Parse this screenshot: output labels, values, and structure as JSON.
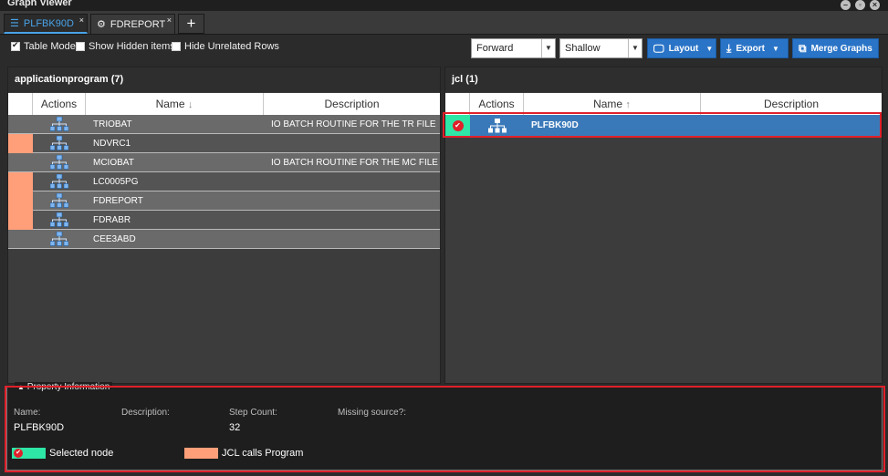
{
  "window": {
    "title": "Graph Viewer"
  },
  "tabs": [
    {
      "label": "PLFBK90D",
      "close": "×"
    },
    {
      "label": "FDREPORT",
      "close": "×"
    }
  ],
  "tab_add": "+",
  "toolbar": {
    "table_mode": "Table Mode",
    "show_hidden": "Show Hidden items",
    "hide_unrelated": "Hide Unrelated Rows",
    "direction": "Forward",
    "depth": "Shallow",
    "layout": "Layout",
    "export": "Export",
    "merge": "Merge Graphs"
  },
  "left_panel": {
    "title": "applicationprogram (7)",
    "columns": {
      "actions": "Actions",
      "name": "Name",
      "name_sort": "↓",
      "description": "Description"
    },
    "rows": [
      {
        "name": "TRIOBAT",
        "description": "IO BATCH ROUTINE FOR THE TR FILE",
        "marker": ""
      },
      {
        "name": "NDVRC1",
        "description": "",
        "marker": "#ff9f7a"
      },
      {
        "name": "MCIOBAT",
        "description": "IO BATCH ROUTINE FOR THE MC FILE",
        "marker": ""
      },
      {
        "name": "LC0005PG",
        "description": "",
        "marker": "#ff9f7a"
      },
      {
        "name": "FDREPORT",
        "description": "",
        "marker": "#ff9f7a"
      },
      {
        "name": "FDRABR",
        "description": "",
        "marker": "#ff9f7a"
      },
      {
        "name": "CEE3ABD",
        "description": "",
        "marker": ""
      }
    ]
  },
  "right_panel": {
    "title": "jcl (1)",
    "columns": {
      "actions": "Actions",
      "name": "Name",
      "name_sort": "↑",
      "description": "Description"
    },
    "rows": [
      {
        "name": "PLFBK90D",
        "description": ""
      }
    ]
  },
  "property": {
    "legend": "Property Information",
    "name_label": "Name:",
    "name_value": "PLFBK90D",
    "desc_label": "Description:",
    "step_label": "Step Count:",
    "step_value": "32",
    "missing_label": "Missing source?:",
    "legend_selected": "Selected node",
    "legend_jcl": "JCL calls Program"
  },
  "colors": {
    "accent": "#2a74c7",
    "selected": "#2ee6a6",
    "jcl_calls": "#ff9f7a",
    "highlight": "#e0202a"
  }
}
